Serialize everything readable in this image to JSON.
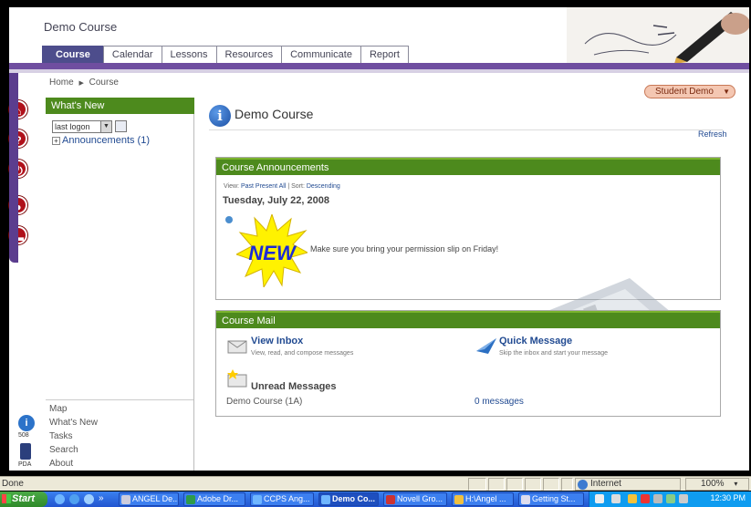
{
  "header": {
    "course_title": "Demo Course",
    "tabs": [
      {
        "label": "Course",
        "active": true
      },
      {
        "label": "Calendar"
      },
      {
        "label": "Lessons"
      },
      {
        "label": "Resources"
      },
      {
        "label": "Communicate"
      },
      {
        "label": "Report"
      }
    ]
  },
  "breadcrumb": {
    "home": "Home",
    "separator": "▶",
    "current": "Course"
  },
  "user_menu": {
    "label": "Student Demo"
  },
  "left_panel": {
    "title": "What's New",
    "filter_value": "last logon",
    "announcements": "Announcements (1)",
    "footer_links": [
      "Map",
      "What's New",
      "Tasks",
      "Search",
      "About"
    ]
  },
  "rail": {
    "label_508": "508",
    "label_pda": "PDA"
  },
  "main": {
    "title": "Demo Course",
    "refresh": "Refresh",
    "announcements_panel": {
      "title": "Course Announcements",
      "view_prefix": "View:",
      "view_past": "Past",
      "view_present": "Present",
      "view_all": "All",
      "sort_prefix": "| Sort:",
      "sort_value": "Descending",
      "date": "Tuesday, July 22, 2008",
      "badge": "NEW",
      "message": "Make sure you bring your permission slip on Friday!"
    },
    "mail_panel": {
      "title": "Course Mail",
      "inbox_title": "View Inbox",
      "inbox_sub": "View, read, and compose messages",
      "quick_title": "Quick Message",
      "quick_sub": "Skip the inbox and start your message",
      "unread_title": "Unread Messages",
      "unread_course": "Demo Course (1A)",
      "unread_count": "0 messages"
    }
  },
  "statusbar": {
    "status": "Done",
    "zone": "Internet",
    "zoom": "100%"
  },
  "taskbar": {
    "start": "Start",
    "tasks": [
      "ANGEL De...",
      "Adobe Dr...",
      "CCPS Ang...",
      "Demo Co...",
      "Novell Gro...",
      "H:\\Angel ...",
      "Getting St..."
    ],
    "clock": "12:30 PM"
  },
  "colors": {
    "accent_green": "#4d8a1d",
    "tab_purple": "#4d4d8c",
    "header_rule": "#6f4ea0",
    "link_blue": "#224b92"
  }
}
